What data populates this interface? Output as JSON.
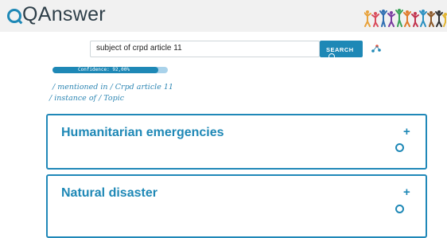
{
  "header": {
    "logo_text": "QAnswer",
    "accent_color": "#1e88b6"
  },
  "search": {
    "query": "subject of crpd article 11",
    "button_label": "SEARCH",
    "button_icon": "search-icon",
    "share_icon": "share-icon"
  },
  "confidence": {
    "label": "Confidence: 92,00%",
    "value_percent": 92
  },
  "path": {
    "line1": "/ mentioned in / Crpd article 11",
    "line2": "/ instance of / Topic"
  },
  "results": [
    {
      "title": "Humanitarian emergencies",
      "expand_icon": "plus-icon",
      "status_icon": "loading-ring-icon"
    },
    {
      "title": "Natural disaster",
      "expand_icon": "plus-icon",
      "status_icon": "loading-ring-icon"
    }
  ]
}
